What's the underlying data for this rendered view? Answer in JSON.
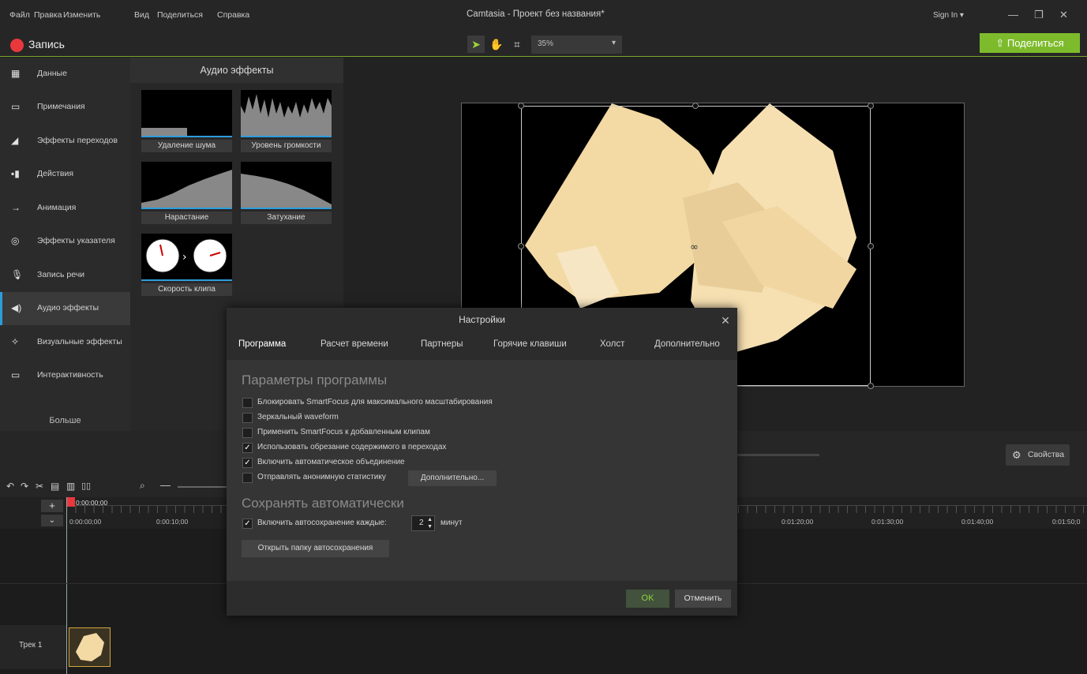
{
  "app": {
    "window_title": "Camtasia - Проект без названия*",
    "sign_in": "Sign In ▾"
  },
  "menu": [
    "Файл",
    "Правка",
    "Изменить",
    "Вид",
    "Поделиться",
    "Справка"
  ],
  "toolbar": {
    "record_label": "Запись",
    "zoom": "35%",
    "share_label": "Поделиться"
  },
  "sidebar": {
    "items": [
      {
        "label": "Данные",
        "icon": "film-icon"
      },
      {
        "label": "Примечания",
        "icon": "annotation-icon"
      },
      {
        "label": "Эффекты переходов",
        "icon": "transition-icon"
      },
      {
        "label": "Действия",
        "icon": "behaviors-icon"
      },
      {
        "label": "Анимация",
        "icon": "animation-icon"
      },
      {
        "label": "Эффекты указателя",
        "icon": "cursor-icon"
      },
      {
        "label": "Запись речи",
        "icon": "microphone-icon"
      },
      {
        "label": "Аудио эффекты",
        "icon": "speaker-icon"
      },
      {
        "label": "Визуальные эффекты",
        "icon": "magic-wand-icon"
      },
      {
        "label": "Интерактивность",
        "icon": "interactive-icon"
      }
    ],
    "more": "Больше",
    "active_index": 7
  },
  "library": {
    "title": "Аудио эффекты",
    "effects": [
      "Удаление шума",
      "Уровень громкости",
      "Нарастание",
      "Затухание",
      "Скорость клипа"
    ]
  },
  "properties_label": "Свойства",
  "timeline": {
    "playhead": "0:00:00;00",
    "ticks": [
      "0:00:00;00",
      "0:00:10;00",
      "0:01:20;00",
      "0:01:30;00",
      "0:01:40;00",
      "0:01:50;0"
    ],
    "track_label": "Трек 1"
  },
  "dialog": {
    "title": "Настройки",
    "tabs": [
      "Программа",
      "Расчет времени",
      "Партнеры",
      "Горячие клавиши",
      "Холст",
      "Дополнительно"
    ],
    "selected_tab": 0,
    "section1": "Параметры программы",
    "options": [
      {
        "label": "Блокировать SmartFocus для максимального масштабирования",
        "checked": false
      },
      {
        "label": "Зеркальный waveform",
        "checked": false
      },
      {
        "label": "Применить SmartFocus к добавленным клипам",
        "checked": false
      },
      {
        "label": "Использовать обрезание содержимого в переходах",
        "checked": true
      },
      {
        "label": "Включить автоматическое объединение",
        "checked": true
      },
      {
        "label": "Отправлять анонимную статистику",
        "checked": false
      }
    ],
    "advanced_button": "Дополнительно...",
    "section2": "Сохранять автоматически",
    "autosave_label": "Включить автосохранение каждые:",
    "autosave_value": "2",
    "autosave_unit": "минут",
    "open_folder": "Открыть папку автосохранения",
    "ok": "OK",
    "cancel": "Отменить"
  }
}
